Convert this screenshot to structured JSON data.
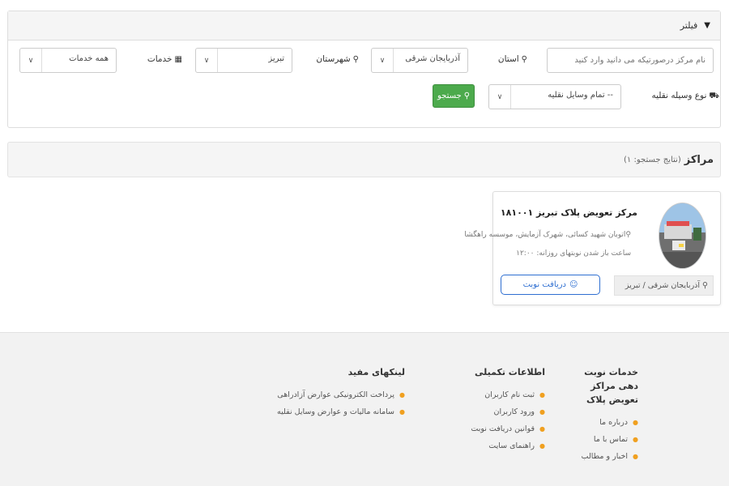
{
  "filter": {
    "header": "فیلتر",
    "header_icon": "funnel-icon",
    "name_placeholder": "نام مرکز درصورتیکه می دانید وارد کنید",
    "province": {
      "label": "استان",
      "value": "آذربایجان شرقی"
    },
    "city": {
      "label": "شهرستان",
      "value": "تبریز"
    },
    "services": {
      "label": "خدمات",
      "value": "همه خدمات"
    },
    "vehicle": {
      "label": "نوع وسیله نقلیه",
      "value": "-- تمام وسایل نقلیه"
    },
    "search_button": "جستجو"
  },
  "results": {
    "title": "مراکز",
    "count_text": "(نتایج جستجو: ۱)"
  },
  "centers": [
    {
      "name": "مرکز تعویض پلاک تبریز ۱۸۱۰۰۱",
      "address": "اتوبان شهید کسائی، شهرک آزمایش، موسسه راهگشا",
      "hours": "ساعت باز شدن نوبتهای روزانه: ۱۲:۰۰",
      "location": "آذربایجان شرقی / تبریز",
      "appointment_button": "دریافت نوبت"
    }
  ],
  "footer": {
    "col1": {
      "title": "خدمات نوبت دهی مراکز تعویض پلاک",
      "items": [
        "درباره ما",
        "تماس با ما",
        "اخبار و مطالب"
      ]
    },
    "col2": {
      "title": "اطلاعات تکمیلی",
      "items": [
        "ثبت نام کاربران",
        "ورود کاربران",
        "قوانین دریافت نوبت",
        "راهنمای سایت"
      ]
    },
    "col3": {
      "title": "لینکهای مفید",
      "items": [
        "پرداخت الکترونیکی عوارض آزادراهی",
        "سامانه مالیات و عوارض وسایل نقلیه"
      ]
    }
  },
  "colors": {
    "search_button": "#4caa4c",
    "appointment_border": "#2f6fd1",
    "bullet": "#f0a020"
  }
}
